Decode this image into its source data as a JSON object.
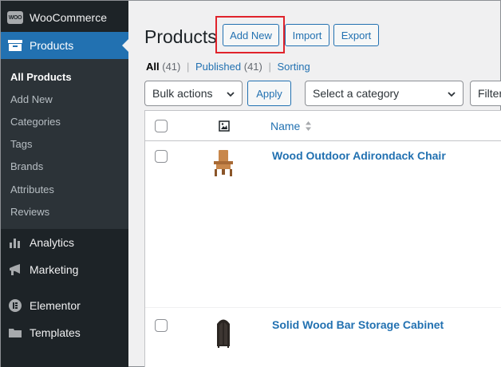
{
  "sidebar": {
    "woocommerce": {
      "label": "WooCommerce",
      "badge": "WOO"
    },
    "products": {
      "label": "Products"
    },
    "submenu": [
      {
        "label": "All Products",
        "current": true
      },
      {
        "label": "Add New"
      },
      {
        "label": "Categories"
      },
      {
        "label": "Tags"
      },
      {
        "label": "Brands"
      },
      {
        "label": "Attributes"
      },
      {
        "label": "Reviews"
      }
    ],
    "analytics": {
      "label": "Analytics"
    },
    "marketing": {
      "label": "Marketing"
    },
    "elementor": {
      "label": "Elementor"
    },
    "templates": {
      "label": "Templates"
    }
  },
  "header": {
    "title": "Products",
    "add_new": "Add New",
    "import": "Import",
    "export": "Export"
  },
  "filters": {
    "all": {
      "label": "All",
      "count": "(41)"
    },
    "published": {
      "label": "Published",
      "count": "(41)"
    },
    "sorting": "Sorting",
    "separator": "|"
  },
  "toolbar": {
    "bulk_actions": "Bulk actions",
    "apply": "Apply",
    "category": "Select a category",
    "filter_partial": "Filter"
  },
  "table": {
    "columns": {
      "name": "Name"
    },
    "rows": [
      {
        "name": "Wood Outdoor Adirondack Chair"
      },
      {
        "name": "Solid Wood Bar Storage Cabinet"
      }
    ]
  },
  "colors": {
    "accent": "#2271b1",
    "sidebar_bg": "#1d2327",
    "highlight": "#e0232b"
  }
}
